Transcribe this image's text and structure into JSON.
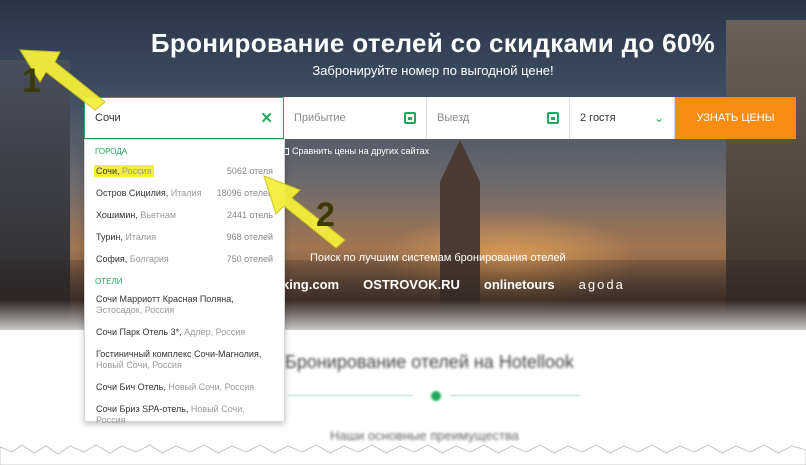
{
  "hero": {
    "title": "Бронирование отелей со скидками до 60%",
    "subtitle": "Забронируйте номер по выгодной цене!"
  },
  "search": {
    "city_value": "Сочи",
    "clear_icon": "close-icon",
    "checkin_placeholder": "Прибытие",
    "checkout_placeholder": "Выезд",
    "guests_value": "2 гостя",
    "submit_label": "УЗНАТЬ ЦЕНЫ",
    "compare_label": "Сравнить цены на других сайтах",
    "accent": "#22a95e",
    "submit_color": "#f98d13"
  },
  "dropdown": {
    "cities_header": "ГОРОДА",
    "cities": [
      {
        "name": "Сочи,",
        "country": "Россия",
        "count": "5062 отеля"
      },
      {
        "name": "Остров Сицилия,",
        "country": "Италия",
        "count": "18096 отелей"
      },
      {
        "name": "Хошимин,",
        "country": "Вьетнам",
        "count": "2441 отель"
      },
      {
        "name": "Турин,",
        "country": "Италия",
        "count": "968 отелей"
      },
      {
        "name": "София,",
        "country": "Болгария",
        "count": "750 отелей"
      }
    ],
    "hotels_header": "ОТЕЛИ",
    "hotels": [
      {
        "name": "Сочи Марриотт Красная Поляна,",
        "location": "Эстосадок, Россия"
      },
      {
        "name": "Сочи Парк Отель 3*,",
        "location": "Адлер, Россия"
      },
      {
        "name": "Гостиничный комплекс Сочи-Магнолия,",
        "location": "Новый Сочи, Россия"
      },
      {
        "name": "Сочи Бич Отель,",
        "location": "Новый Сочи, Россия"
      },
      {
        "name": "Сочи Бриз SPA-отель,",
        "location": "Новый Сочи, Россия"
      }
    ]
  },
  "partners": {
    "title": "Поиск по лучшим системам бронирования отелей",
    "logos": [
      "king.com",
      "OSTROVOK.RU",
      "onlinetours",
      "agoda"
    ]
  },
  "section": {
    "title": "Бронирование отелей на Hotellook",
    "subtitle": "Наши основные преимущества"
  },
  "annotations": {
    "step1": "1",
    "step2": "2"
  }
}
